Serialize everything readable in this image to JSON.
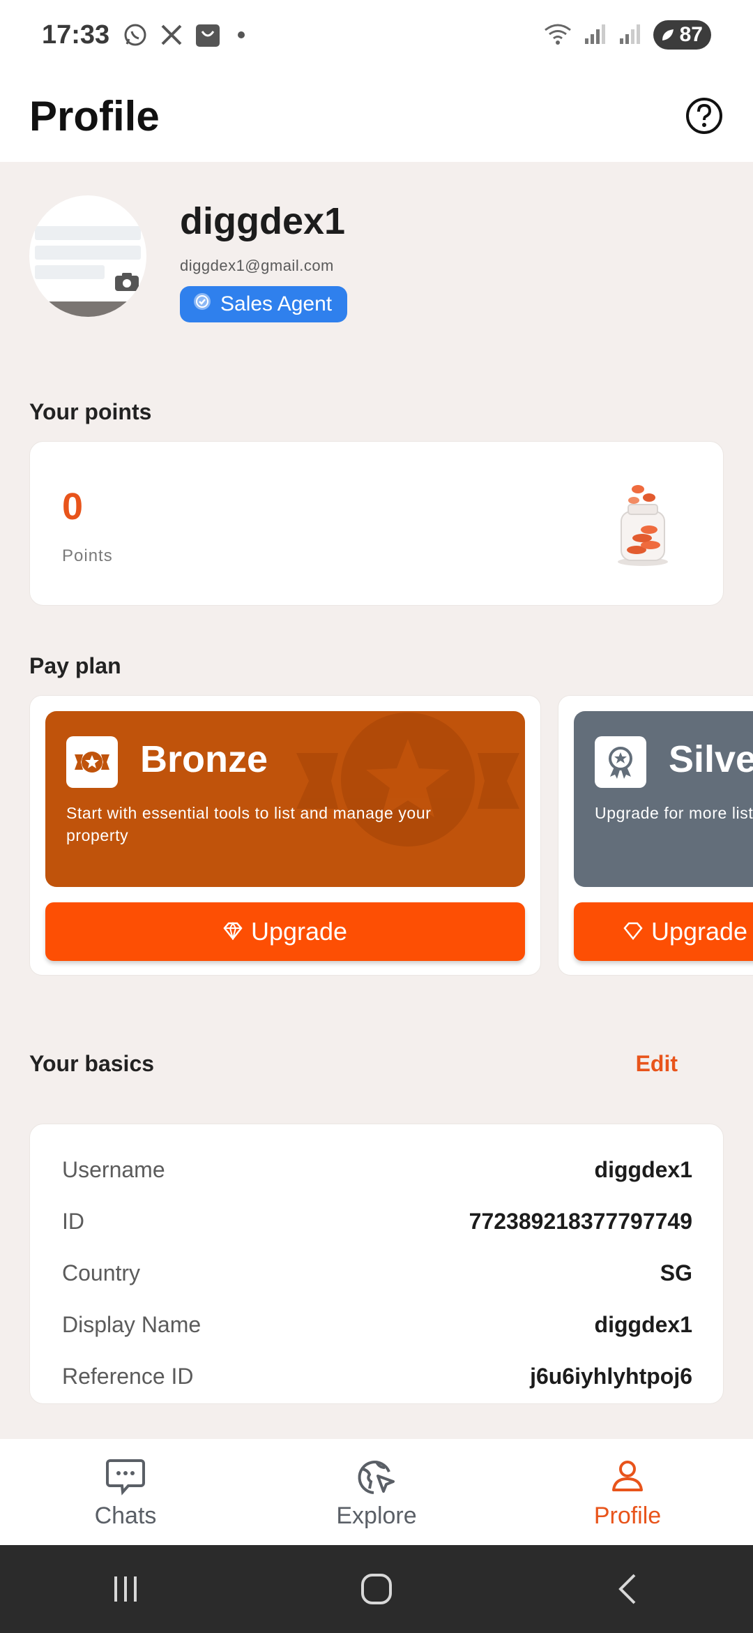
{
  "status_bar": {
    "time": "17:33",
    "battery": "87",
    "left_icons": [
      "whatsapp-icon",
      "x-icon",
      "shop-icon"
    ],
    "right_icons": [
      "wifi-icon",
      "signal-icon",
      "signal-roaming-icon",
      "battery-icon"
    ]
  },
  "header": {
    "title": "Profile",
    "help_icon": "help-circle-icon"
  },
  "profile": {
    "name": "diggdex1",
    "email": "diggdex1@gmail.com",
    "role": "Sales Agent"
  },
  "points_section": {
    "title": "Your points",
    "value": "0",
    "label": "Points"
  },
  "pay_plan": {
    "title": "Pay plan",
    "plans": [
      {
        "name": "Bronze",
        "description": "Start with essential tools to list and manage your property",
        "button": "Upgrade",
        "color": "#c0530b"
      },
      {
        "name": "Silver",
        "description": "Upgrade for more listing features.",
        "button": "Upgrade",
        "color": "#636e7a"
      }
    ],
    "button_color": "#fd4f04"
  },
  "basics": {
    "title": "Your basics",
    "edit": "Edit",
    "rows": [
      {
        "key": "Username",
        "value": "diggdex1"
      },
      {
        "key": "ID",
        "value": "772389218377797749"
      },
      {
        "key": "Country",
        "value": "SG"
      },
      {
        "key": "Display Name",
        "value": "diggdex1"
      },
      {
        "key": "Reference ID",
        "value": "j6u6iyhlyhtpoj6"
      }
    ]
  },
  "bottom_nav": {
    "items": [
      {
        "label": "Chats",
        "icon": "chat-icon"
      },
      {
        "label": "Explore",
        "icon": "explore-icon"
      },
      {
        "label": "Profile",
        "icon": "profile-icon",
        "active": true
      }
    ]
  },
  "accent_color": "#e8541b"
}
